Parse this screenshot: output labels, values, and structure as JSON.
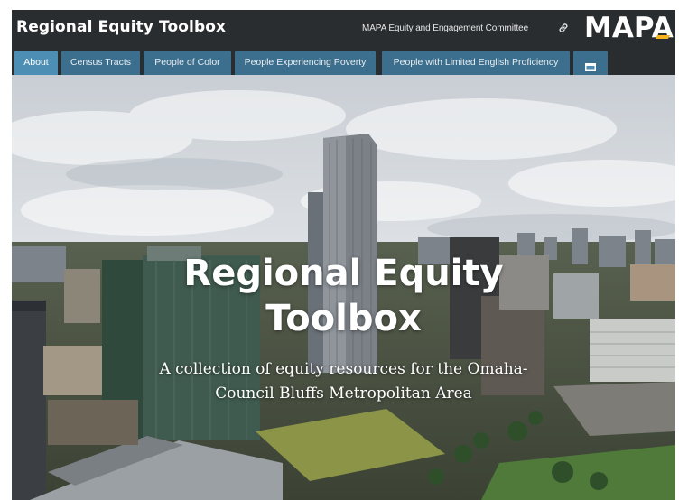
{
  "header": {
    "title": "Regional Equity Toolbox",
    "org_link_text": "MAPA Equity and Engagement Committee",
    "logo_text": "MAPA",
    "link_icon": "link-icon"
  },
  "tabs": [
    {
      "label": "About",
      "active": true
    },
    {
      "label": "Census Tracts",
      "active": false
    },
    {
      "label": "People of Color",
      "active": false
    },
    {
      "label": "People Experiencing Poverty",
      "active": false
    },
    {
      "label": "People with Limited English Proficiency",
      "active": false
    },
    {
      "label": "",
      "icon": "window-icon",
      "active": false
    }
  ],
  "hero": {
    "title_line1": "Regional Equity",
    "title_line2": "Toolbox",
    "subtitle_line1": "A collection of equity resources for the Omaha-",
    "subtitle_line2": "Council Bluffs Metropolitan Area"
  },
  "colors": {
    "header_bg": "#2a2d30",
    "tab_bg": "#3c6f8d",
    "tab_active_bg": "#4d8fb4",
    "logo_accent": "#f4b41a"
  }
}
